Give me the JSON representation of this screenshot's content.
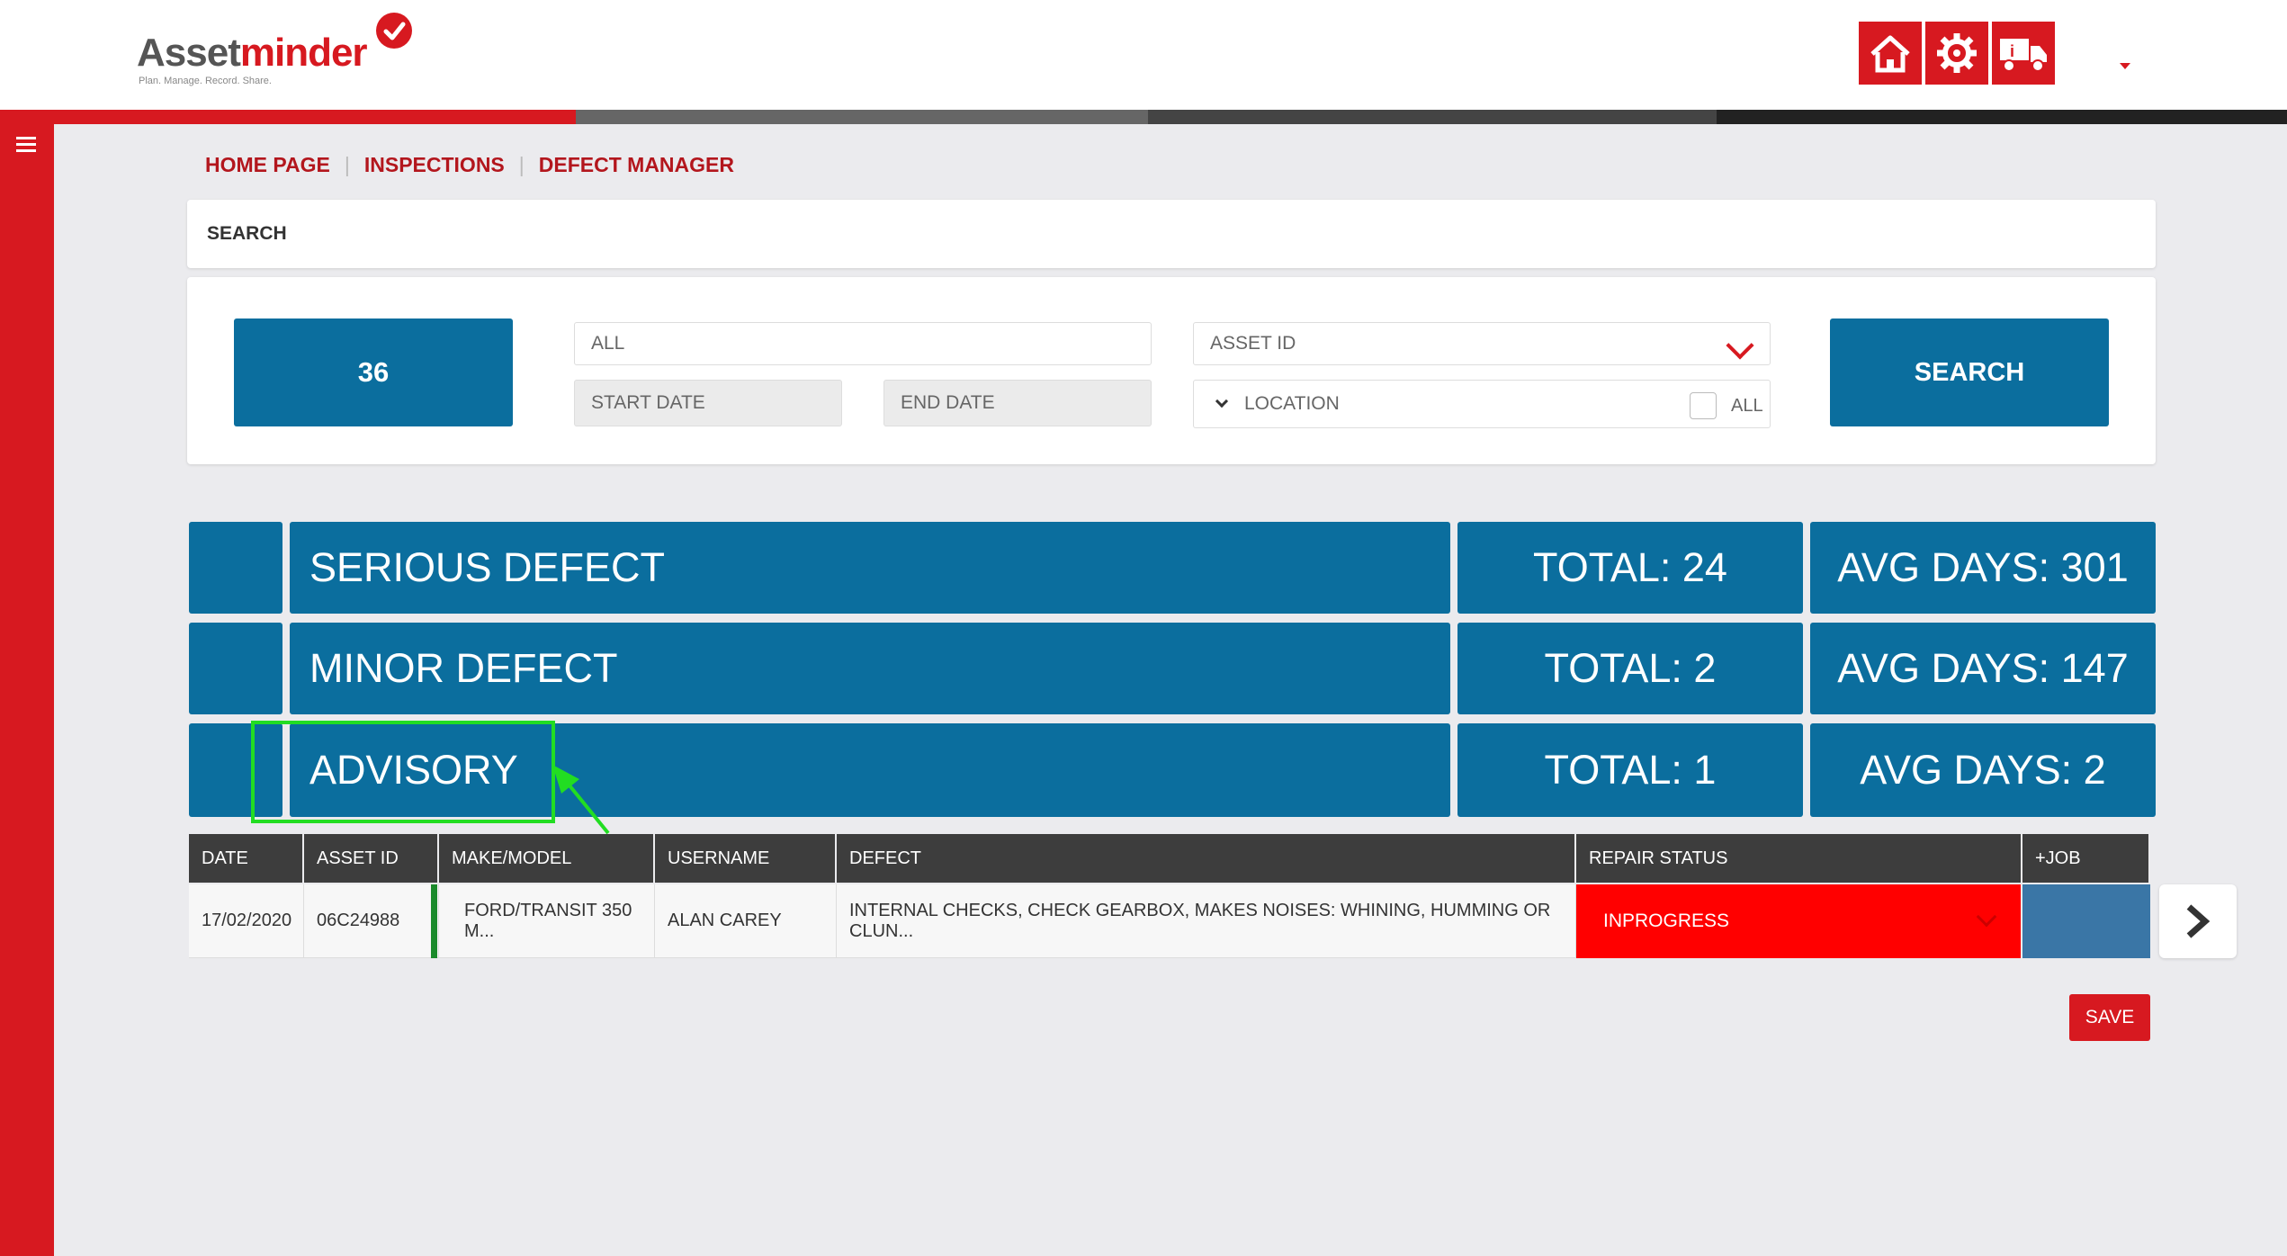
{
  "brand": {
    "name_part1": "Asset",
    "name_part2": "minder",
    "tagline": "Plan. Manage. Record. Share.",
    "accent_color": "#d71920",
    "primary_color": "#0b6e9e"
  },
  "header": {
    "icons": [
      "home-icon",
      "gear-icon",
      "truck-icon"
    ]
  },
  "breadcrumb": [
    "HOME PAGE",
    "INSPECTIONS",
    "DEFECT MANAGER"
  ],
  "search": {
    "section_label": "SEARCH",
    "count": "36",
    "filter_value": "ALL",
    "start_date_placeholder": "START DATE",
    "end_date_placeholder": "END DATE",
    "asset_id_label": "ASSET ID",
    "location_label": "LOCATION",
    "all_checkbox_label": "ALL",
    "button_label": "SEARCH"
  },
  "defect_summary": [
    {
      "name": "SERIOUS DEFECT",
      "total": "TOTAL: 24",
      "avg_days": "AVG DAYS: 301"
    },
    {
      "name": "MINOR DEFECT",
      "total": "TOTAL: 2",
      "avg_days": "AVG DAYS: 147"
    },
    {
      "name": "ADVISORY",
      "total": "TOTAL: 1",
      "avg_days": "AVG DAYS: 2"
    }
  ],
  "table": {
    "columns": [
      "DATE",
      "ASSET ID",
      "MAKE/MODEL",
      "USERNAME",
      "DEFECT",
      "REPAIR STATUS",
      "+JOB"
    ],
    "rows": [
      {
        "date": "17/02/2020",
        "asset_id": "06C24988",
        "make_model": "FORD/TRANSIT 350 M...",
        "username": "ALAN CAREY",
        "defect": "INTERNAL CHECKS, CHECK GEARBOX, MAKES NOISES: WHINING, HUMMING OR CLUN...",
        "repair_status": "INPROGRESS"
      }
    ]
  },
  "save_label": "SAVE"
}
